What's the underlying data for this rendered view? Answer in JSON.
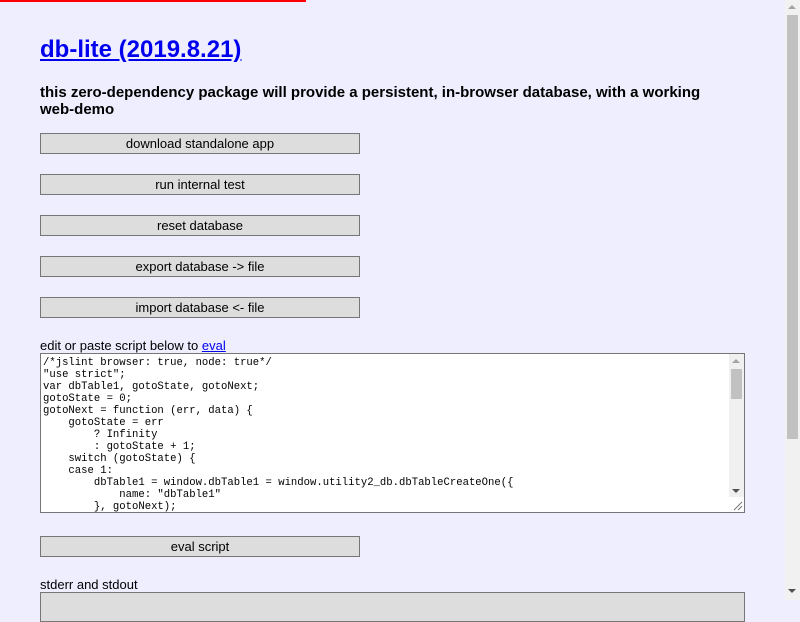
{
  "progress": {
    "fraction": 0.39,
    "color": "#ff0000"
  },
  "header": {
    "title": "db-lite (2019.8.21)",
    "description": "this zero-dependency package will provide a persistent, in-browser database, with a working web-demo"
  },
  "buttons": {
    "download": "download standalone app",
    "test": "run internal test",
    "reset": "reset database",
    "export": "export database -> file",
    "import": "import database <- file",
    "eval": "eval script"
  },
  "editor": {
    "label_prefix": "edit or paste script below to ",
    "label_link": "eval",
    "code": "/*jslint browser: true, node: true*/\n\"use strict\";\nvar dbTable1, gotoState, gotoNext;\ngotoState = 0;\ngotoNext = function (err, data) {\n    gotoState = err\n        ? Infinity\n        : gotoState + 1;\n    switch (gotoState) {\n    case 1:\n        dbTable1 = window.dbTable1 = window.utility2_db.dbTableCreateOne({\n            name: \"dbTable1\"\n        }, gotoNext);"
  },
  "output": {
    "label": "stderr and stdout"
  },
  "icons": {
    "scroll_up": "chevron-up-icon",
    "scroll_down": "chevron-down-icon",
    "resize": "resize-grip-icon"
  }
}
